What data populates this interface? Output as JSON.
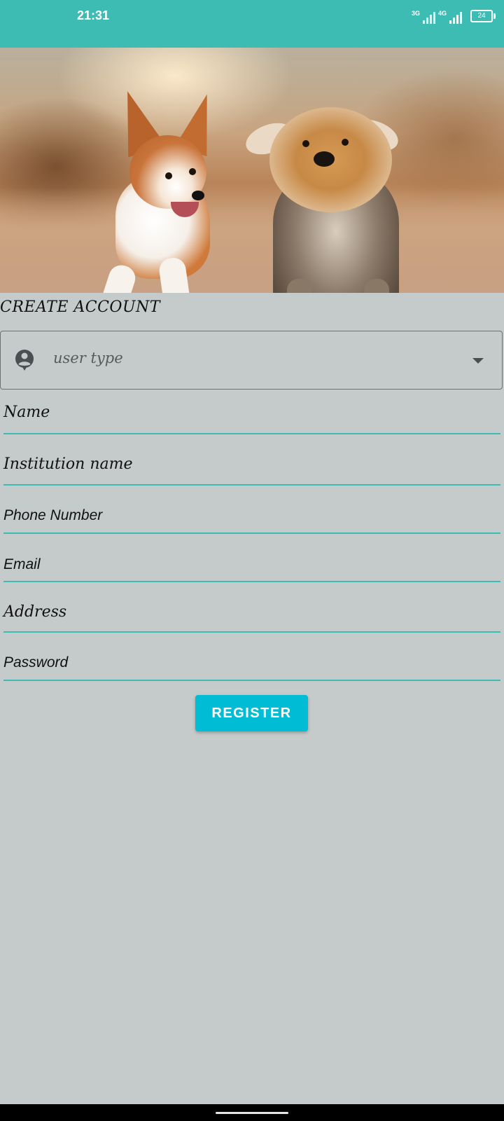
{
  "colors": {
    "status_bar": "#3dbcb3",
    "accent": "#3dbcb3",
    "background": "#c5cacb",
    "button": "#00bcd4",
    "button_text": "#ffffff"
  },
  "status_bar": {
    "time": "21:31",
    "network_1": "3G",
    "network_2": "4G",
    "battery": "24"
  },
  "hero": {
    "icon": "dogs-photo"
  },
  "form": {
    "title": "CREATE ACCOUNT",
    "user_type": {
      "placeholder": "user type",
      "icon": "account-circle-icon"
    },
    "fields": {
      "name": "Name",
      "institution": "Institution name",
      "phone": "Phone Number",
      "email": "Email",
      "address": "Address",
      "password": "Password"
    },
    "register_label": "REGISTER"
  }
}
